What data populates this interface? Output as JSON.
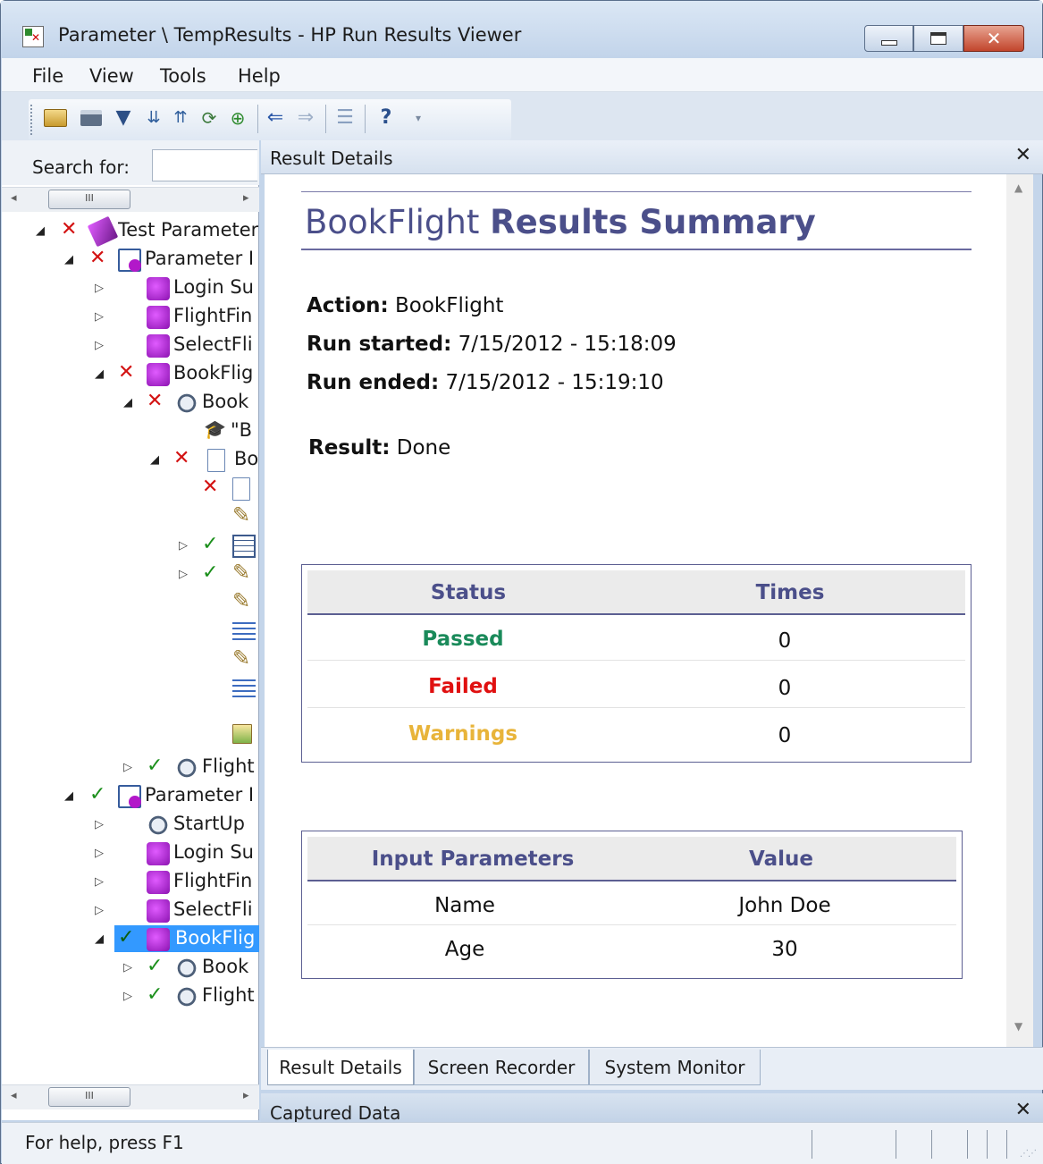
{
  "window": {
    "title": "Parameter \\ TempResults - HP Run Results Viewer"
  },
  "menu": [
    "File",
    "View",
    "Tools",
    "Help"
  ],
  "search": {
    "label": "Search for:",
    "value": ""
  },
  "tree": [
    {
      "label": "Test Parameter",
      "status": "fail",
      "icon": "test-icon"
    },
    {
      "label": "Parameter I",
      "status": "fail",
      "icon": "iteration-icon"
    },
    {
      "label": "Login Su",
      "status": "",
      "icon": "action-icon"
    },
    {
      "label": "FlightFin",
      "status": "",
      "icon": "action-icon"
    },
    {
      "label": "SelectFli",
      "status": "",
      "icon": "action-icon"
    },
    {
      "label": "BookFlig",
      "status": "fail",
      "icon": "action-icon"
    },
    {
      "label": "Book",
      "status": "fail",
      "icon": "step-icon"
    },
    {
      "label": "\"B",
      "status": "",
      "icon": "checkpoint-icon"
    },
    {
      "label": "Bo",
      "status": "fail",
      "icon": "page-icon"
    },
    {
      "label": "",
      "status": "fail",
      "icon": "page-icon"
    },
    {
      "label": "",
      "status": "",
      "icon": "pencil-icon"
    },
    {
      "label": "",
      "status": "pass",
      "icon": "table-icon"
    },
    {
      "label": "",
      "status": "pass",
      "icon": "pencil-icon"
    },
    {
      "label": "",
      "status": "",
      "icon": "pencil-icon"
    },
    {
      "label": "",
      "status": "",
      "icon": "list-icon"
    },
    {
      "label": "",
      "status": "",
      "icon": "pencil-icon"
    },
    {
      "label": "",
      "status": "",
      "icon": "list-icon"
    },
    {
      "label": "",
      "status": "",
      "icon": "image-icon"
    },
    {
      "label": "Flight",
      "status": "pass",
      "icon": "step-icon"
    },
    {
      "label": "Parameter I",
      "status": "pass",
      "icon": "iteration-icon"
    },
    {
      "label": "StartUp",
      "status": "",
      "icon": "step-icon"
    },
    {
      "label": "Login Su",
      "status": "",
      "icon": "action-icon"
    },
    {
      "label": "FlightFin",
      "status": "",
      "icon": "action-icon"
    },
    {
      "label": "SelectFli",
      "status": "",
      "icon": "action-icon"
    },
    {
      "label": "BookFlig",
      "status": "pass",
      "icon": "action-icon",
      "selected": true
    },
    {
      "label": "Book",
      "status": "pass",
      "icon": "step-icon"
    },
    {
      "label": "Flight",
      "status": "pass",
      "icon": "step-icon"
    }
  ],
  "result_details": {
    "pane_title": "Result Details",
    "heading_name": "BookFlight",
    "heading_suffix": "Results Summary",
    "action_label": "Action:",
    "action_value": "BookFlight",
    "run_started_label": "Run started:",
    "run_started_value": "7/15/2012 - 15:18:09",
    "run_ended_label": "Run ended:",
    "run_ended_value": "7/15/2012 - 15:19:10",
    "result_label": "Result:",
    "result_value": "Done",
    "status_table": {
      "headers": [
        "Status",
        "Times"
      ],
      "rows": [
        {
          "status": "Passed",
          "times": "0",
          "color": "#1a8a5a"
        },
        {
          "status": "Failed",
          "times": "0",
          "color": "#e01010"
        },
        {
          "status": "Warnings",
          "times": "0",
          "color": "#e8b43a"
        }
      ]
    },
    "params_table": {
      "headers": [
        "Input Parameters",
        "Value"
      ],
      "rows": [
        {
          "name": "Name",
          "value": "John Doe"
        },
        {
          "name": "Age",
          "value": "30"
        }
      ]
    }
  },
  "tabs": [
    "Result Details",
    "Screen Recorder",
    "System Monitor"
  ],
  "captured": {
    "label": "Captured Data"
  },
  "statusbar": {
    "text": "For help, press F1"
  },
  "colors": {
    "accent": "#4b4f8a",
    "passed": "#1a8a5a",
    "failed": "#e01010",
    "warning": "#e8b43a",
    "selection": "#3399ff"
  }
}
